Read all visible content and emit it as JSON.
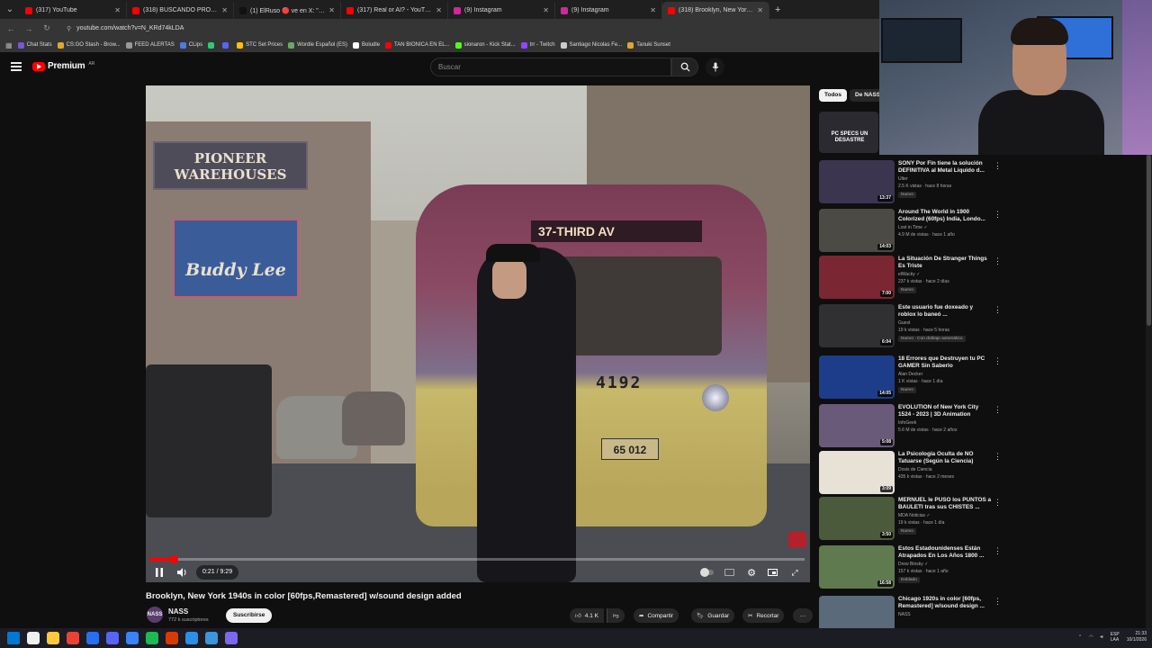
{
  "browser": {
    "tabs": [
      {
        "label": "(317) YouTube",
        "color": "#ff0000",
        "active": false
      },
      {
        "label": "(318) BUSCANDO PROBLEMAS",
        "color": "#ff0000",
        "active": false
      },
      {
        "label": "(1) ElRuso 🔴 ve en X: \"https://",
        "color": "#111111",
        "active": false
      },
      {
        "label": "(317) Real or AI? - YouTube",
        "color": "#ff0000",
        "active": false
      },
      {
        "label": "(9) Instagram",
        "color": "#d6249f",
        "active": false
      },
      {
        "label": "(9) Instagram",
        "color": "#d6249f",
        "active": false
      },
      {
        "label": "(318) Brooklyn, New York 1",
        "color": "#ff0000",
        "active": true
      }
    ],
    "new_tab": "+",
    "url": "youtube.com/watch?v=N_KRd74kLDA",
    "bookmarks": [
      {
        "label": "Chat Stats",
        "color": "#7a55d6"
      },
      {
        "label": "CS:GO Stash - Brow...",
        "color": "#e0a630"
      },
      {
        "label": "FEED ALERTAS",
        "color": "#999999"
      },
      {
        "label": "CLips",
        "color": "#4f7be0"
      },
      {
        "label": "",
        "color": "#2ecc71"
      },
      {
        "label": "",
        "color": "#5865f2"
      },
      {
        "label": "STC Set Prices",
        "color": "#ffc107"
      },
      {
        "label": "Wordle Español (ES)",
        "color": "#6aaa64"
      },
      {
        "label": "Boludle",
        "color": "#ffffff"
      },
      {
        "label": "TAN BIONICA EN EL...",
        "color": "#ff0000"
      },
      {
        "label": "sionaron - Kick Stat...",
        "color": "#53fc18"
      },
      {
        "label": "trr - Twitch",
        "color": "#9146ff"
      },
      {
        "label": "Santiago Nicolas Fe...",
        "color": "#cccccc"
      },
      {
        "label": "Tanuki Sunset",
        "color": "#e0a630"
      }
    ]
  },
  "youtube": {
    "brand": "Premium",
    "region": "AR",
    "search_placeholder": "Buscar",
    "video": {
      "signs": {
        "top": "PIONEER WAREHOUSES",
        "middle": "Buddy Lee"
      },
      "bus_destination": "37-THIRD AV",
      "bus_number": "4192",
      "bus_plate": "65 012",
      "time": "0:21 / 9:29",
      "progress": 0.037
    },
    "title": "Brooklyn, New York 1940s in color [60fps,Remastered] w/sound design added",
    "channel": {
      "name": "NASS",
      "avatar_text": "NASS",
      "subscribers": "772 k suscriptores"
    },
    "subscribe_label": "Suscribirse",
    "actions": {
      "likes": "4.1 K",
      "share": "Compartir",
      "save": "Guardar",
      "clip": "Recortar",
      "more": "···"
    },
    "chips": [
      {
        "label": "Todos",
        "selected": true
      },
      {
        "label": "De NASS",
        "selected": false
      }
    ],
    "recommendations": [
      {
        "title": "PC SPECS UN DESASTRE",
        "channel": "",
        "meta": "",
        "badge": "",
        "duration": "",
        "thumb": "#2a2a30"
      },
      {
        "title": "SONY Por Fin tiene la solución DEFINITIVA al Metal Líquido d...",
        "channel": "Ulter",
        "meta": "2.5 K vistas · hace 8 horas",
        "badge": "Nuevo",
        "duration": "13:37",
        "thumb": "#3b3550"
      },
      {
        "title": "Around The World in 1900 Colorized (60fps) India, Londo...",
        "channel": "Lost in Time ✓",
        "meta": "4.9 M de vistas · hace 1 año",
        "badge": "",
        "duration": "14:03",
        "thumb": "#4c4a44"
      },
      {
        "title": "La Situación De Stranger Things Es Triste",
        "channel": "elWacky ✓",
        "meta": "237 k vistas · hace 2 días",
        "badge": "Nuevo",
        "duration": "7:00",
        "thumb": "#7a2633"
      },
      {
        "title": "Este usuario fue doxeado y roblox lo baneó ...",
        "channel": "Guest",
        "meta": "19 k vistas · hace 5 horas",
        "badge": "Nuevo  ·  Con doblaje automático",
        "duration": "6:04",
        "thumb": "#303033"
      },
      {
        "title": "18 Errores que Destruyen tu PC GAMER Sin Saberlo",
        "channel": "Alan Decker",
        "meta": "1 K vistas · hace 1 día",
        "badge": "Nuevo",
        "duration": "14:05",
        "thumb": "#1d3d8a"
      },
      {
        "title": "EVOLUTION of New York City 1524 - 2023 | 3D Animation",
        "channel": "InfoGeek",
        "meta": "5.6 M de vistas · hace 2 años",
        "badge": "",
        "duration": "5:08",
        "thumb": "#6a5a7a"
      },
      {
        "title": "La Psicología Oculta de NO Tatuarse (Según la Ciencia)",
        "channel": "Dosis de Ciencia",
        "meta": "435 k vistas · hace 2 meses",
        "badge": "",
        "duration": "3:09",
        "thumb": "#e8e2d6"
      },
      {
        "title": "MERNUEL le PUSO los PUNTOS a BAULETI tras sus CHISTES ...",
        "channel": "MDA Noticias ✓",
        "meta": "19 k vistas · hace 1 día",
        "badge": "Nuevo",
        "duration": "3:50",
        "thumb": "#4a5a3a"
      },
      {
        "title": "Estos Estadounidenses Están Atrapados En Los Años 1800 ...",
        "channel": "Drew Binsky ✓",
        "meta": "157 k vistas · hace 1 año",
        "badge": "Doblado",
        "duration": "16:58",
        "thumb": "#5e7a4e"
      },
      {
        "title": "Chicago 1920s in color [60fps, Remastered] w/sound design ...",
        "channel": "NASS",
        "meta": "",
        "badge": "",
        "duration": "",
        "thumb": "#5a6a7a"
      }
    ]
  },
  "taskbar": {
    "apps": [
      "#0078d4",
      "#f0f0f0",
      "#ffc83d",
      "#ea4335",
      "#2a6ef0",
      "#5865f2",
      "#3a82f7",
      "#1db954",
      "#d83b01",
      "#2c8ee6",
      "#3a96dd",
      "#7b68ee"
    ],
    "lang": "ESP\nLAA",
    "time": "21:33",
    "date": "10/1/2026"
  }
}
